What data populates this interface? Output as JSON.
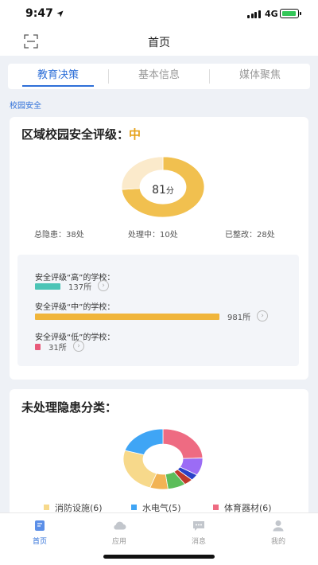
{
  "status": {
    "time": "9:47",
    "network": "4G"
  },
  "nav": {
    "title": "首页"
  },
  "tabs": [
    {
      "label": "教育决策",
      "active": true
    },
    {
      "label": "基本信息",
      "active": false
    },
    {
      "label": "媒体聚焦",
      "active": false
    }
  ],
  "section_label": "校园安全",
  "safety_card": {
    "title_prefix": "区域校园安全评级：",
    "level": "中",
    "score": "81",
    "score_unit": "分",
    "stats": {
      "total": "总隐患：38处",
      "processing": "处理中：10处",
      "fixed": "已整改：28处"
    },
    "rows": [
      {
        "label": "安全评级“高”的学校：",
        "value": "137所",
        "count": 137,
        "color": "#4cc4b6"
      },
      {
        "label": "安全评级“中”的学校：",
        "value": "981所",
        "count": 981,
        "color": "#f0b53b"
      },
      {
        "label": "安全评级“低”的学校：",
        "value": "31所",
        "count": 31,
        "color": "#e85a7a"
      }
    ]
  },
  "hazard_card": {
    "title": "未处理隐患分类：",
    "legend": [
      {
        "label": "消防设施(6)",
        "color": "#f7d98b"
      },
      {
        "label": "水电气(5)",
        "color": "#3fa5f5"
      },
      {
        "label": "体育器材(6)",
        "color": "#ee6b82"
      }
    ]
  },
  "chart_data": [
    {
      "type": "pie",
      "title": "",
      "labels": [
        "已整改",
        "处理中"
      ],
      "values": [
        28,
        10
      ],
      "center_label": "81分",
      "colors": [
        "#f1c04f",
        "#fbeacb"
      ]
    },
    {
      "type": "pie",
      "title": "未处理隐患分类",
      "labels": [
        "体育器材",
        "",
        "",
        "",
        "",
        "",
        "消防设施",
        "水电气"
      ],
      "values": [
        6,
        2.3,
        0.8,
        0.9,
        1.8,
        1.8,
        6,
        5
      ],
      "colors": [
        "#ee6b82",
        "#9b6cf5",
        "#2a42c8",
        "#c0392b",
        "#5cbd5a",
        "#f2b354",
        "#f7d98b",
        "#3fa5f5"
      ]
    }
  ],
  "tabbar": [
    {
      "label": "首页",
      "icon": "home-doc-icon",
      "active": true
    },
    {
      "label": "应用",
      "icon": "cloud-icon",
      "active": false
    },
    {
      "label": "消息",
      "icon": "message-icon",
      "active": false
    },
    {
      "label": "我的",
      "icon": "user-icon",
      "active": false
    }
  ]
}
